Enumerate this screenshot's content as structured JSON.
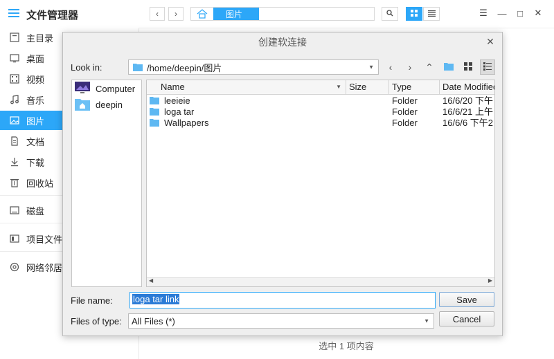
{
  "file_manager": {
    "title": "文件管理器",
    "sidebar": {
      "items": [
        {
          "label": "主目录",
          "icon": "home-icon"
        },
        {
          "label": "桌面",
          "icon": "desktop-icon"
        },
        {
          "label": "视频",
          "icon": "video-icon"
        },
        {
          "label": "音乐",
          "icon": "music-icon"
        },
        {
          "label": "图片",
          "icon": "picture-icon",
          "active": true
        },
        {
          "label": "文档",
          "icon": "document-icon"
        },
        {
          "label": "下载",
          "icon": "download-icon"
        },
        {
          "label": "回收站",
          "icon": "trash-icon"
        },
        {
          "label": "磁盘",
          "icon": "disk-icon"
        },
        {
          "label": "项目文件",
          "icon": "project-icon"
        },
        {
          "label": "网络邻居",
          "icon": "network-icon"
        }
      ]
    },
    "breadcrumb": {
      "current": "图片"
    },
    "status": "选中 1 项内容",
    "accent_color": "#2ca7f8"
  },
  "dialog": {
    "title": "创建软连接",
    "look_in_label": "Look in:",
    "look_in_value": "/home/deepin/图片",
    "places": [
      {
        "label": "Computer",
        "icon": "computer-icon"
      },
      {
        "label": "deepin",
        "icon": "home-folder-icon"
      }
    ],
    "columns": [
      "Name",
      "Size",
      "Type",
      "Date Modified"
    ],
    "files": [
      {
        "name": "leeieie",
        "size": "",
        "type": "Folder",
        "date": "16/6/20 下午"
      },
      {
        "name": "loga tar",
        "size": "",
        "type": "Folder",
        "date": "16/6/21 上午"
      },
      {
        "name": "Wallpapers",
        "size": "",
        "type": "Folder",
        "date": "16/6/6 下午2"
      }
    ],
    "file_name_label": "File name:",
    "file_name_value": "loga tar link",
    "files_of_type_label": "Files of type:",
    "files_of_type_value": "All Files (*)",
    "save_label": "Save",
    "cancel_label": "Cancel"
  }
}
